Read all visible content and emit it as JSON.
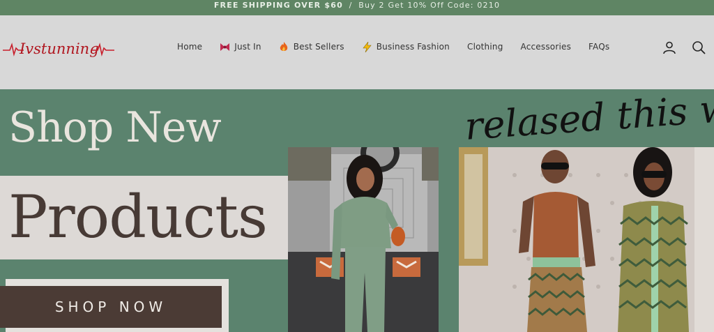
{
  "announcement": {
    "free_shipping": "FREE SHIPPING OVER $60",
    "divider": "/",
    "promo": "Buy 2 Get 10% Off Code: 0210"
  },
  "brand": {
    "logo_text": "Ivstunning"
  },
  "nav": {
    "items": [
      {
        "label": "Home",
        "icon": ""
      },
      {
        "label": "Just In",
        "icon": "bow-icon"
      },
      {
        "label": "Best Sellers",
        "icon": "fire-icon"
      },
      {
        "label": "Business Fashion",
        "icon": "lightning-icon"
      },
      {
        "label": "Clothing",
        "icon": ""
      },
      {
        "label": "Accessories",
        "icon": ""
      },
      {
        "label": "FAQs",
        "icon": ""
      }
    ]
  },
  "header_icons": {
    "account": "account-icon",
    "search": "search-icon"
  },
  "hero": {
    "line1": "Shop New",
    "line2": "Products",
    "button": "SHOP NOW",
    "script_text": "relased this we"
  },
  "colors": {
    "announce_bg": "#5f8564",
    "header_bg": "#d8d8d8",
    "hero_bg": "#5b836e",
    "button_bg": "#4b3b35",
    "accent_red": "#c81e2b"
  }
}
